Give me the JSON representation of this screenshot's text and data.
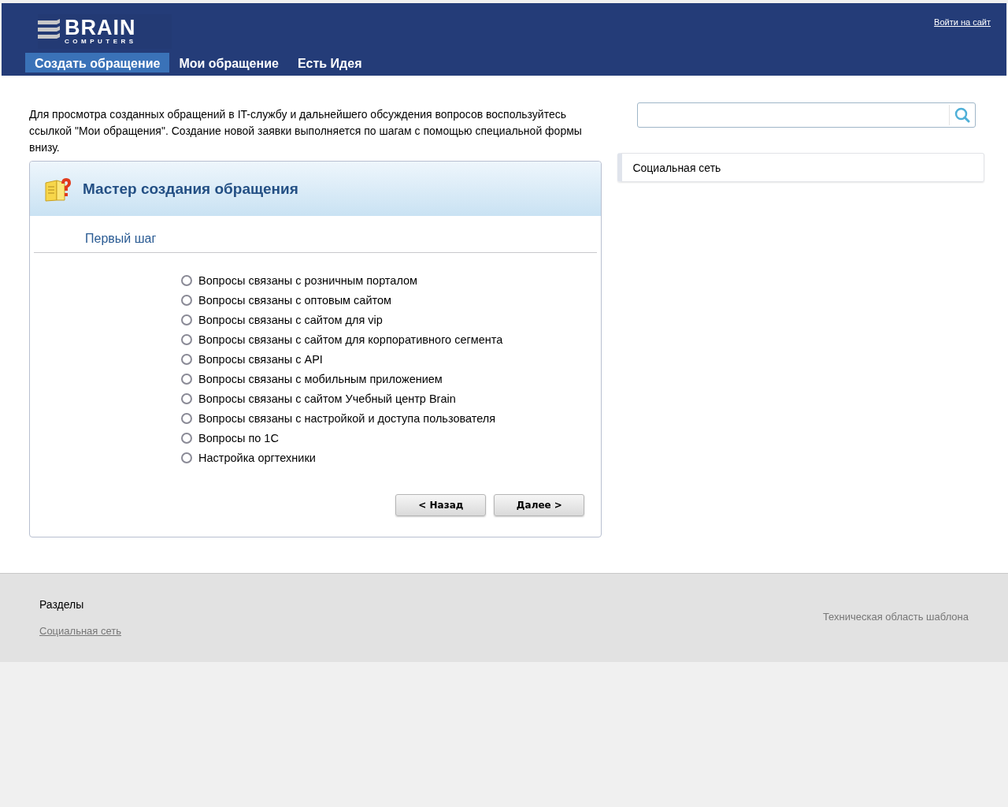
{
  "header": {
    "logo": {
      "name": "BRAIN",
      "tagline": "COMPUTERS"
    },
    "login_link": "Войти на сайт",
    "nav": [
      {
        "label": "Создать обращение",
        "selected": true
      },
      {
        "label": "Мои обращение",
        "selected": false
      },
      {
        "label": "Есть Идея",
        "selected": false
      }
    ]
  },
  "intro": "Для просмотра созданных обращений в IT-службу и дальнейшего обсуждения вопросов воспользуйтесь ссылкой \"Мои обращения\". Создание новой заявки выполняется по шагам с помощью специальной формы внизу.",
  "wizard": {
    "title": "Мастер создания обращения",
    "step": "Первый шаг",
    "options": [
      {
        "label": "Вопросы связаны с розничным порталом",
        "selected": false
      },
      {
        "label": "Вопросы связаны с оптовым сайтом",
        "selected": false
      },
      {
        "label": "Вопросы связаны с сайтом для vip",
        "selected": false
      },
      {
        "label": "Вопросы связаны с сайтом для корпоративного сегмента",
        "selected": false
      },
      {
        "label": "Вопросы связаны с API",
        "selected": false
      },
      {
        "label": "Вопросы связаны с мобильным приложением",
        "selected": false
      },
      {
        "label": "Вопросы связаны с сайтом Учебный центр Brain",
        "selected": false
      },
      {
        "label": "Вопросы связаны с настройкой и доступа пользователя",
        "selected": false
      },
      {
        "label": "Вопросы по 1С",
        "selected": false
      },
      {
        "label": "Настройка оргтехники",
        "selected": false
      }
    ],
    "buttons": [
      "< Назад",
      "Далее >"
    ]
  },
  "sidebar": {
    "items": [
      "Социальная сеть"
    ]
  },
  "footer": {
    "heading": "Разделы",
    "links": [
      "Социальная сеть"
    ],
    "note": "Техническая область шаблона"
  }
}
